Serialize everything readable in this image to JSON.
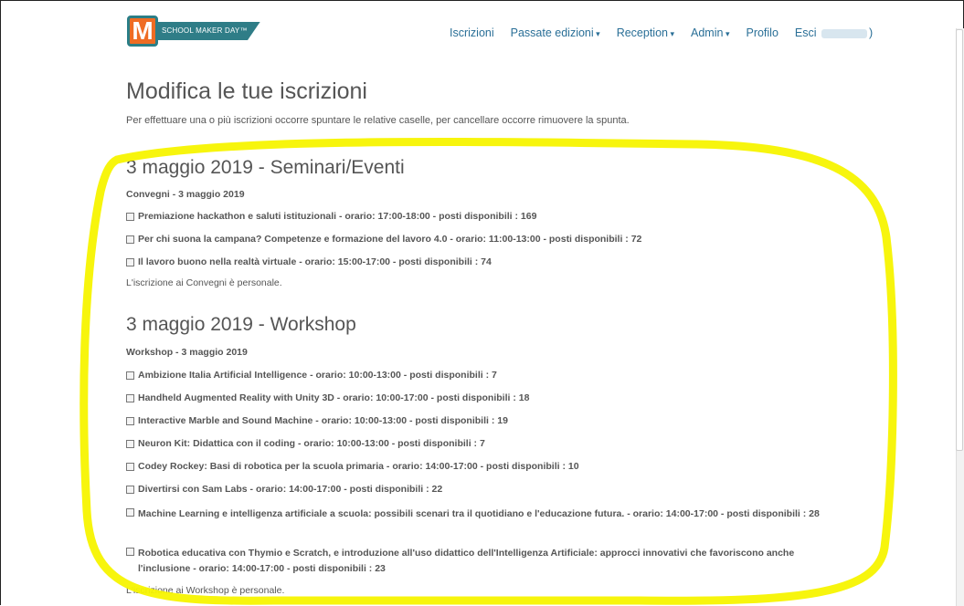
{
  "brand": {
    "logo_letter": "M",
    "logo_text": "SCHOOL MAKER DAY™"
  },
  "nav": {
    "items": [
      "Iscrizioni",
      "Passate edizioni",
      "Reception",
      "Admin",
      "Profilo"
    ],
    "logout_label": "Esci",
    "logout_suffix": ")"
  },
  "page": {
    "title": "Modifica le tue iscrizioni",
    "intro": "Per effettuare una o più iscrizioni occorre spuntare le relative caselle, per cancellare occorre rimuovere la spunta."
  },
  "sections": [
    {
      "title": "3 maggio 2019 - Seminari/Eventi",
      "subtitle": "Convegni - 3 maggio 2019",
      "items": [
        "Premiazione hackathon e saluti istituzionali - orario: 17:00-18:00 - posti disponibili : 169",
        "Per chi suona la campana? Competenze e formazione del lavoro 4.0 - orario: 11:00-13:00 - posti disponibili : 72",
        "Il lavoro buono nella realtà virtuale - orario: 15:00-17:00 - posti disponibili : 74"
      ],
      "note": "L'iscrizione ai Convegni è personale."
    },
    {
      "title": "3 maggio 2019 - Workshop",
      "subtitle": "Workshop - 3 maggio 2019",
      "items": [
        "Ambizione Italia Artificial Intelligence - orario: 10:00-13:00 - posti disponibili : 7",
        "Handheld Augmented Reality with Unity 3D - orario: 10:00-17:00 - posti disponibili : 18",
        "Interactive Marble and Sound Machine - orario: 10:00-13:00 - posti disponibili : 19",
        "Neuron Kit: Didattica con il coding - orario: 10:00-13:00 - posti disponibili : 7",
        "Codey Rockey: Basi di robotica per la scuola primaria - orario: 14:00-17:00 - posti disponibili : 10",
        "Divertirsi con Sam Labs - orario: 14:00-17:00 - posti disponibili : 22",
        "Machine Learning e intelligenza artificiale a scuola: possibili scenari tra il quotidiano e l'educazione futura. - orario: 14:00-17:00 - posti disponibili : 28",
        "Robotica educativa con Thymio e Scratch, e introduzione all'uso didattico dell'Intelligenza Artificiale: approcci innovativi che favoriscono anche l'inclusione - orario: 14:00-17:00 - posti disponibili : 23"
      ],
      "note": "L'iscrizione ai Workshop è personale."
    }
  ],
  "colors": {
    "link": "#2a6f97",
    "highlight": "#f7f400",
    "logo_orange": "#ef6c23",
    "logo_teal": "#2f7d87"
  }
}
